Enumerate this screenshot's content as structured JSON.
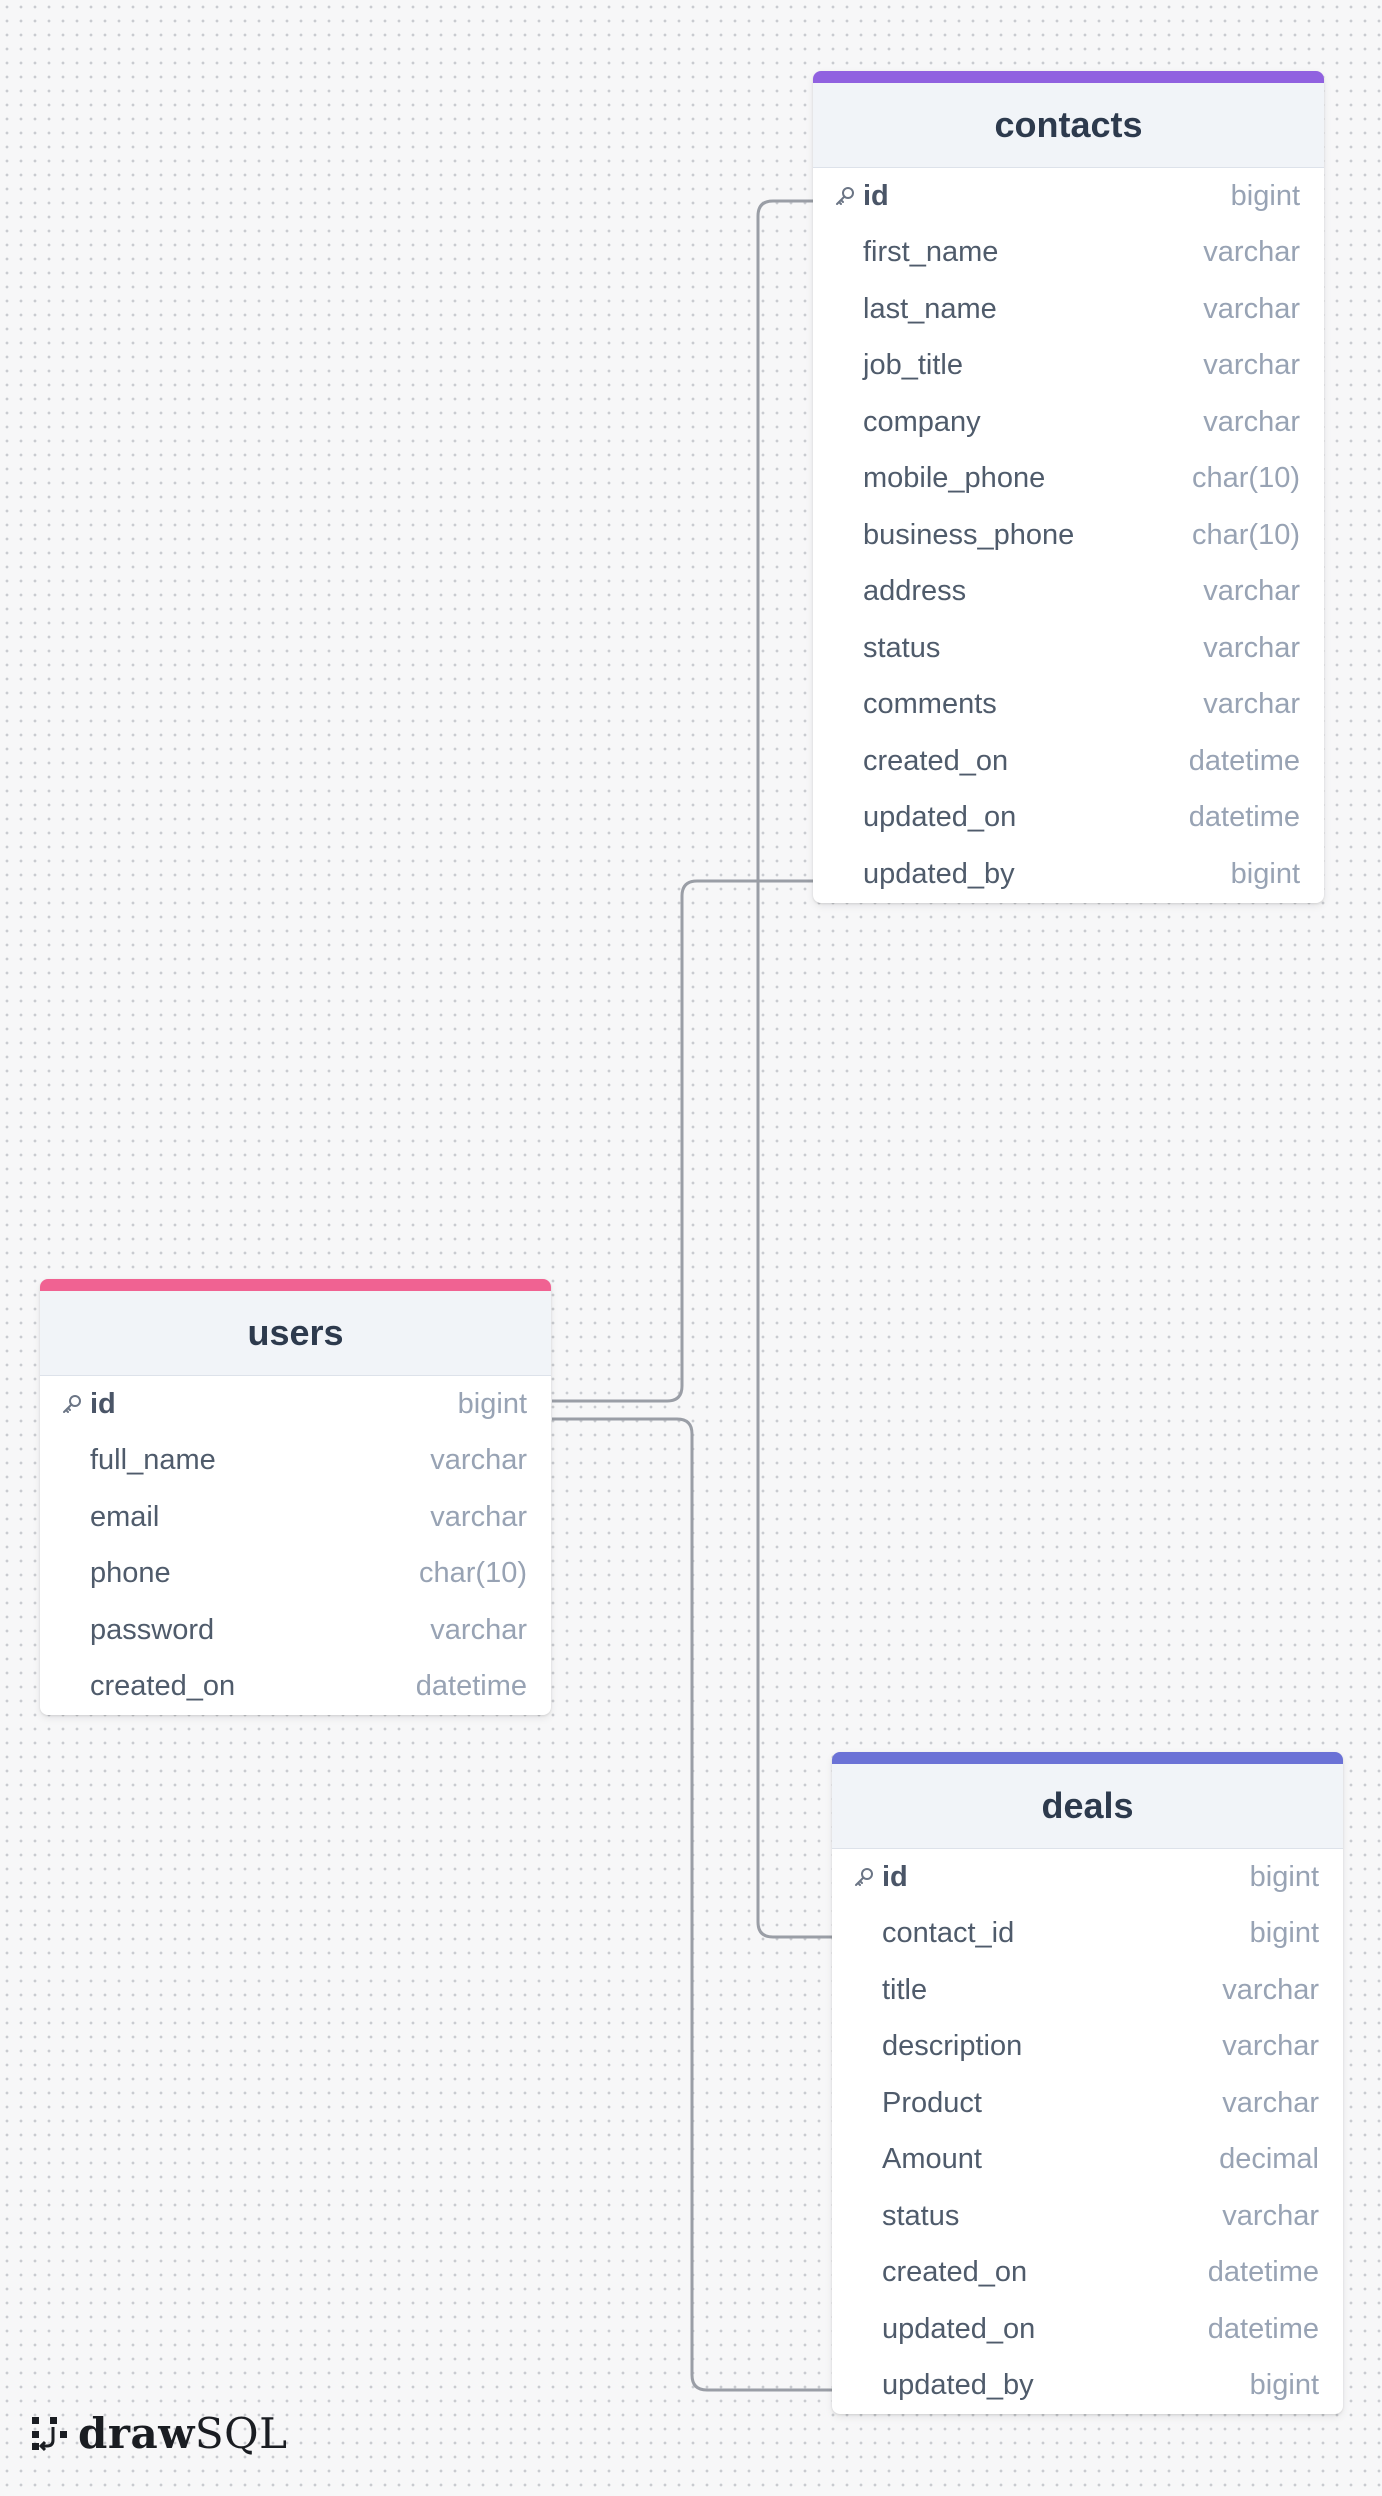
{
  "tables": {
    "contacts": {
      "name": "contacts",
      "accent": "#9061e0",
      "columns": [
        {
          "name": "id",
          "type": "bigint",
          "pk": true
        },
        {
          "name": "first_name",
          "type": "varchar"
        },
        {
          "name": "last_name",
          "type": "varchar"
        },
        {
          "name": "job_title",
          "type": "varchar"
        },
        {
          "name": "company",
          "type": "varchar"
        },
        {
          "name": "mobile_phone",
          "type": "char(10)"
        },
        {
          "name": "business_phone",
          "type": "char(10)"
        },
        {
          "name": "address",
          "type": "varchar"
        },
        {
          "name": "status",
          "type": "varchar"
        },
        {
          "name": "comments",
          "type": "varchar"
        },
        {
          "name": "created_on",
          "type": "datetime"
        },
        {
          "name": "updated_on",
          "type": "datetime"
        },
        {
          "name": "updated_by",
          "type": "bigint"
        }
      ]
    },
    "users": {
      "name": "users",
      "accent": "#f06292",
      "columns": [
        {
          "name": "id",
          "type": "bigint",
          "pk": true
        },
        {
          "name": "full_name",
          "type": "varchar"
        },
        {
          "name": "email",
          "type": "varchar"
        },
        {
          "name": "phone",
          "type": "char(10)"
        },
        {
          "name": "password",
          "type": "varchar"
        },
        {
          "name": "created_on",
          "type": "datetime"
        }
      ]
    },
    "deals": {
      "name": "deals",
      "accent": "#6b72d6",
      "columns": [
        {
          "name": "id",
          "type": "bigint",
          "pk": true
        },
        {
          "name": "contact_id",
          "type": "bigint"
        },
        {
          "name": "title",
          "type": "varchar"
        },
        {
          "name": "description",
          "type": "varchar"
        },
        {
          "name": "Product",
          "type": "varchar"
        },
        {
          "name": "Amount",
          "type": "decimal"
        },
        {
          "name": "status",
          "type": "varchar"
        },
        {
          "name": "created_on",
          "type": "datetime"
        },
        {
          "name": "updated_on",
          "type": "datetime"
        },
        {
          "name": "updated_by",
          "type": "bigint"
        }
      ]
    }
  },
  "relations": [
    {
      "from": "contacts.updated_by",
      "to": "users.id"
    },
    {
      "from": "deals.contact_id",
      "to": "contacts.id"
    },
    {
      "from": "deals.updated_by",
      "to": "users.id"
    }
  ],
  "branding": {
    "draw": "draw",
    "sql": "SQL",
    "icon": "drawsql-logo-icon"
  },
  "icons": {
    "primary_key": "key-icon"
  },
  "colors": {
    "connector": "#9a9ea6",
    "header_bg": "#f1f4f8"
  }
}
